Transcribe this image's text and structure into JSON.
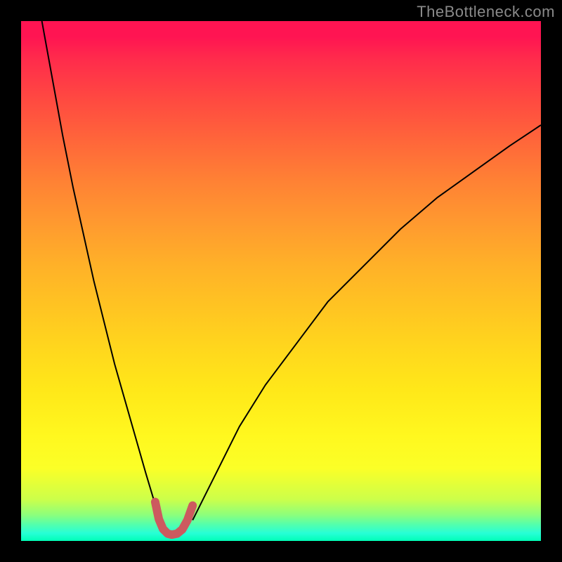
{
  "watermark": "TheBottleneck.com",
  "chart_data": {
    "type": "line",
    "title": "",
    "xlabel": "",
    "ylabel": "",
    "xlim": [
      0,
      100
    ],
    "ylim": [
      0,
      100
    ],
    "gradient_colors": {
      "top": "#ff1452",
      "mid_upper": "#ff8234",
      "mid": "#ffd71d",
      "mid_lower": "#fff81f",
      "bottom": "#00ffb7"
    },
    "series": [
      {
        "name": "left_branch",
        "color": "#000000",
        "width": 2,
        "x": [
          4,
          6,
          8,
          10,
          12,
          14,
          16,
          18,
          20,
          22,
          24,
          25.5,
          26.5
        ],
        "values": [
          100,
          89,
          78,
          68,
          59,
          50,
          42,
          34,
          27,
          20,
          13,
          8,
          4
        ]
      },
      {
        "name": "right_branch",
        "color": "#000000",
        "width": 2,
        "x": [
          33,
          35,
          38,
          42,
          47,
          53,
          59,
          66,
          73,
          80,
          87,
          94,
          100
        ],
        "values": [
          4,
          8,
          14,
          22,
          30,
          38,
          46,
          53,
          60,
          66,
          71,
          76,
          80
        ]
      },
      {
        "name": "trough_marker",
        "color": "#cc5a5f",
        "width": 12,
        "linecap": "round",
        "x": [
          25.8,
          26.5,
          27.3,
          28.2,
          29,
          30,
          31,
          32,
          33
        ],
        "values": [
          7.5,
          4.2,
          2.3,
          1.4,
          1.2,
          1.4,
          2.2,
          4.0,
          6.8
        ]
      }
    ]
  }
}
